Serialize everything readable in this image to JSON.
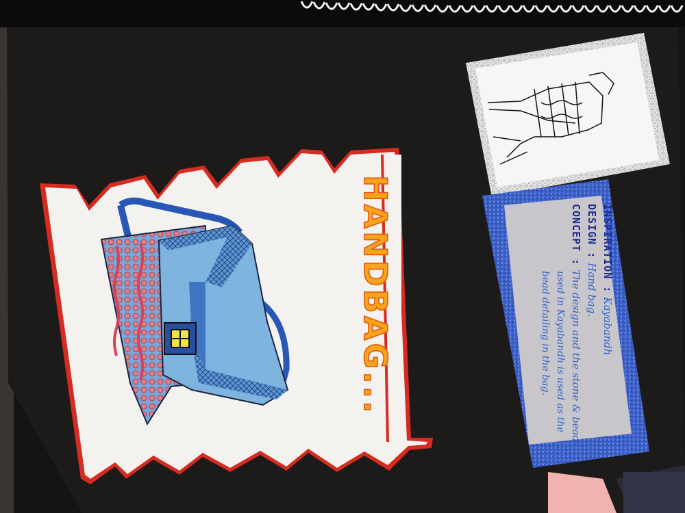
{
  "title": {
    "text": "HANDBAG..."
  },
  "info_card": {
    "inspiration_key": "INSPIRATION :",
    "inspiration_value": "Kayabandh",
    "design_key": "DESIGN :",
    "design_value": "Hand bag.",
    "concept_key": "CONCEPT :",
    "concept_lines": [
      "The design and the stone & beads",
      "used in Kayabandh is used as the",
      "bead detailing in the bag."
    ]
  },
  "colors": {
    "sketchbook": "#1c1a19",
    "paper": "#f2f1ee",
    "red_border": "#d8291f",
    "bag_blue": "#6fa6d6",
    "bag_pink": "#e07f8a",
    "glitter_blue": "#3f63c7",
    "card_grey": "#c9c7cc",
    "silver": "#cfcfcf"
  }
}
